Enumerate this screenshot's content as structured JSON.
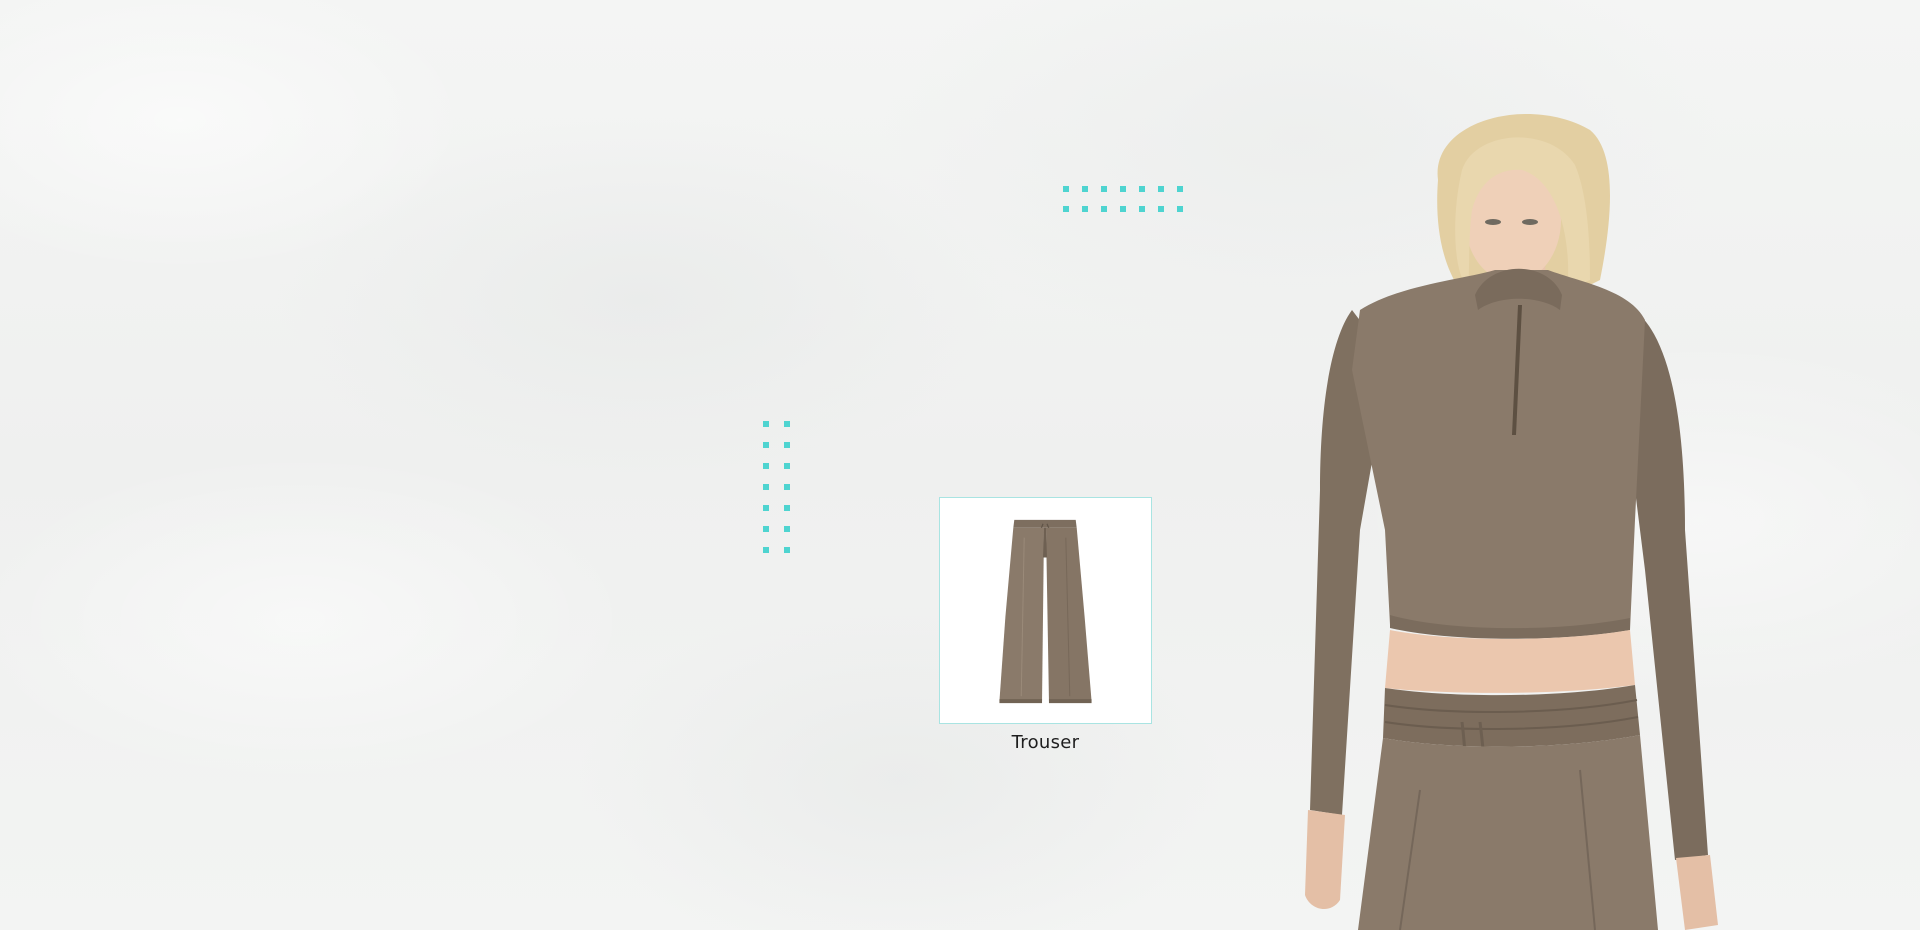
{
  "product": {
    "label": "Trouser",
    "image_icon": "trouser-image"
  },
  "model": {
    "image_icon": "model-photo"
  },
  "colors": {
    "accent_dots": "#4ed4d0",
    "card_border": "#a9e4e2",
    "garment": "#8a7a6a"
  }
}
